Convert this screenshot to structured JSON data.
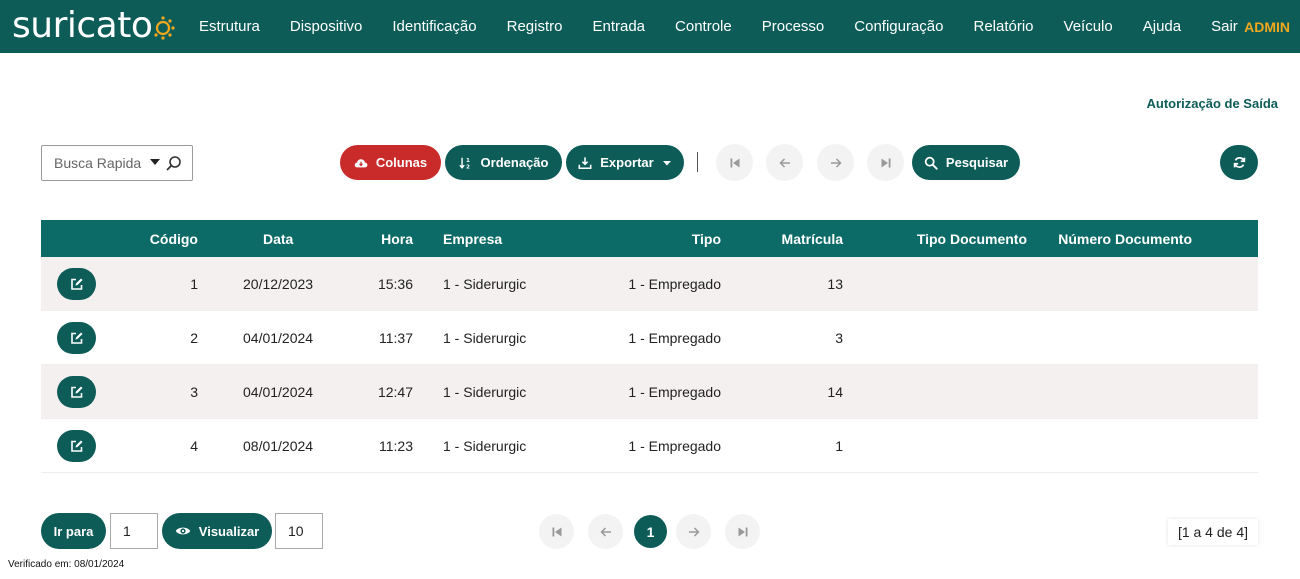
{
  "app": {
    "logo_text": "suricato",
    "user": "ADMIN"
  },
  "nav": {
    "items": [
      "Estrutura",
      "Dispositivo",
      "Identificação",
      "Registro",
      "Entrada",
      "Controle",
      "Processo",
      "Configuração",
      "Relatório",
      "Veículo",
      "Ajuda",
      "Sair"
    ]
  },
  "page": {
    "title": "Autorização de Saída"
  },
  "toolbar": {
    "search_placeholder": "Busca Rapida",
    "colunas_label": "Colunas",
    "ordenacao_label": "Ordenação",
    "exportar_label": "Exportar",
    "pesquisar_label": "Pesquisar"
  },
  "table": {
    "headers": [
      "Código",
      "Data",
      "Hora",
      "Empresa",
      "Tipo",
      "Matrícula",
      "Tipo Documento",
      "Número Documento"
    ],
    "rows": [
      {
        "codigo": "1",
        "data": "20/12/2023",
        "hora": "15:36",
        "empresa": "1 - Siderurgic",
        "tipo": "1 - Empregado",
        "matricula": "13",
        "tipo_documento": "",
        "numero_documento": ""
      },
      {
        "codigo": "2",
        "data": "04/01/2024",
        "hora": "11:37",
        "empresa": "1 - Siderurgic",
        "tipo": "1 - Empregado",
        "matricula": "3",
        "tipo_documento": "",
        "numero_documento": ""
      },
      {
        "codigo": "3",
        "data": "04/01/2024",
        "hora": "12:47",
        "empresa": "1 - Siderurgic",
        "tipo": "1 - Empregado",
        "matricula": "14",
        "tipo_documento": "",
        "numero_documento": ""
      },
      {
        "codigo": "4",
        "data": "08/01/2024",
        "hora": "11:23",
        "empresa": "1 - Siderurgic",
        "tipo": "1 - Empregado",
        "matricula": "1",
        "tipo_documento": "",
        "numero_documento": ""
      }
    ]
  },
  "footer": {
    "ir_para_label": "Ir para",
    "ir_para_value": "1",
    "visualizar_label": "Visualizar",
    "page_size": "10",
    "current_page": "1",
    "range_text": "[1 a 4 de 4]",
    "verified_text": "Verificado em: 08/01/2024"
  },
  "colors": {
    "primary": "#0d5c57",
    "header": "#0d6b67",
    "danger": "#c92b2b",
    "accent": "#f0a81e",
    "row_alt": "#f4f0f0"
  }
}
